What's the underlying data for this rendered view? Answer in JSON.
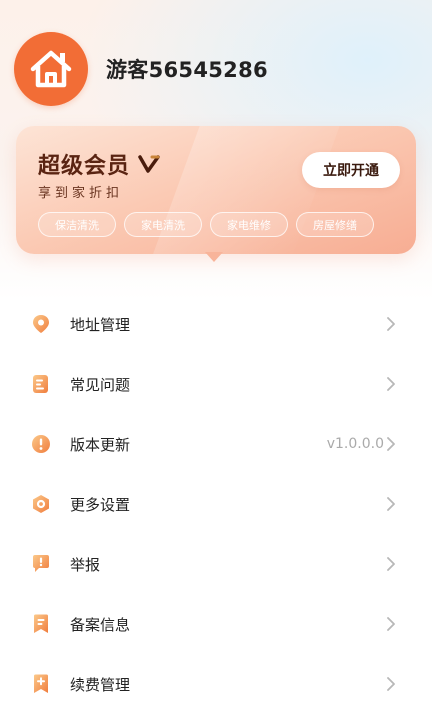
{
  "profile": {
    "username": "游客56545286",
    "avatar_icon": "house-icon",
    "avatar_color": "#f26d36"
  },
  "vip": {
    "title": "超级会员",
    "badge_icon": "v-badge-icon",
    "subtitle": "享到家折扣",
    "button_label": "立即开通",
    "tags": [
      "保洁清洗",
      "家电清洗",
      "家电维修",
      "房屋修缮"
    ]
  },
  "menu": {
    "items": [
      {
        "label": "地址管理",
        "icon": "location-pin-icon",
        "value": ""
      },
      {
        "label": "常见问题",
        "icon": "document-icon",
        "value": ""
      },
      {
        "label": "版本更新",
        "icon": "info-circle-icon",
        "value": "v1.0.0.0"
      },
      {
        "label": "更多设置",
        "icon": "settings-hex-icon",
        "value": ""
      },
      {
        "label": "举报",
        "icon": "report-icon",
        "value": ""
      },
      {
        "label": "备案信息",
        "icon": "bookmark-icon",
        "value": ""
      },
      {
        "label": "续费管理",
        "icon": "renew-bookmark-icon",
        "value": ""
      }
    ]
  },
  "colors": {
    "accent": "#f59a5b",
    "icon_gradient_start": "#fbc27b",
    "icon_gradient_end": "#f07d3e"
  }
}
